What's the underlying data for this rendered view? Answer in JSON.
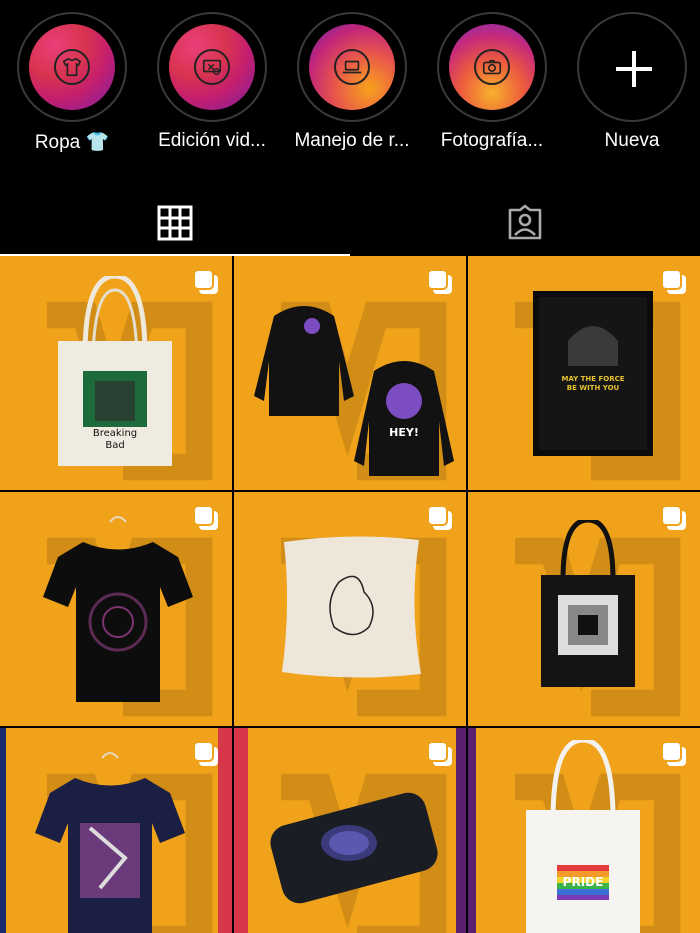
{
  "highlights": [
    {
      "label": "Ropa 👕",
      "icon": "tshirt-icon"
    },
    {
      "label": "Edición vid...",
      "icon": "video-edit-icon"
    },
    {
      "label": "Manejo de r...",
      "icon": "laptop-icon"
    },
    {
      "label": "Fotografía...",
      "icon": "camera-icon"
    },
    {
      "label": "Nueva",
      "icon": "plus-icon"
    }
  ],
  "tabs": [
    {
      "name": "posts-grid",
      "icon": "grid-icon",
      "active": true
    },
    {
      "name": "tagged",
      "icon": "tagged-person-icon",
      "active": false
    }
  ],
  "posts": [
    {
      "item": "Tote bag",
      "print_text": "Breaking\nBad"
    },
    {
      "item": "Hoodies",
      "print_text": "HEY!"
    },
    {
      "item": "Framed poster",
      "print_text": "MAY THE FORCE\nBE WITH YOU"
    },
    {
      "item": "T-shirt spiral",
      "print_text": ""
    },
    {
      "item": "Pillow",
      "print_text": ""
    },
    {
      "item": "Black tote",
      "print_text": ""
    },
    {
      "item": "Navy T-shirt",
      "print_text": ""
    },
    {
      "item": "Phone case",
      "print_text": ""
    },
    {
      "item": "White tote",
      "print_text": "PRIDE"
    }
  ],
  "colors": {
    "accent_orange": "#f0a21a",
    "background": "#000000",
    "text": "#ffffff"
  }
}
